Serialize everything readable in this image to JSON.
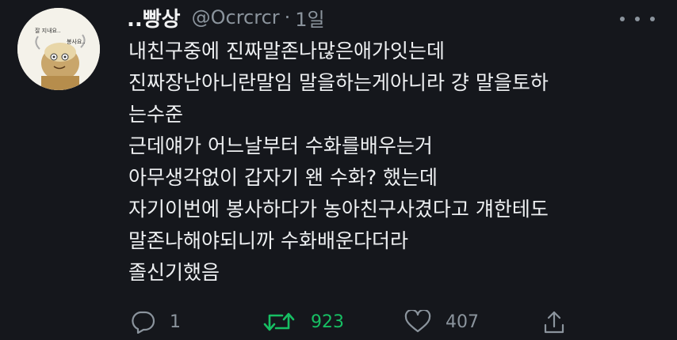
{
  "tweet": {
    "author": {
      "display_name": "..빵상",
      "handle": "@Ocrcrcr",
      "separator": "·",
      "time": "1일",
      "avatar_text_1": "잘 지내요..",
      "avatar_text_2": "봉사요.."
    },
    "body_lines": [
      "내친구중에 진짜말존나많은애가잇는데",
      "진짜장난아니란말임 말을하는게아니라 걍 말을토하",
      "는수준",
      "근데얘가 어느날부터 수화를배우는거",
      "아무생각없이 갑자기 왠 수화? 했는데",
      "자기이번에 봉사하다가 농아친구사겼다고 걔한테도",
      "말존나해야되니까 수화배운다더라",
      "졸신기했음"
    ],
    "actions": {
      "reply_count": "1",
      "retweet_count": "923",
      "like_count": "407"
    },
    "colors": {
      "background": "#15171c",
      "text": "#e7e9ea",
      "muted": "#8b949d",
      "retweet_active": "#17bf63"
    },
    "icons": {
      "more": "more-dots-icon",
      "reply": "reply-icon",
      "retweet": "retweet-icon",
      "like": "heart-icon",
      "share": "share-icon"
    }
  }
}
